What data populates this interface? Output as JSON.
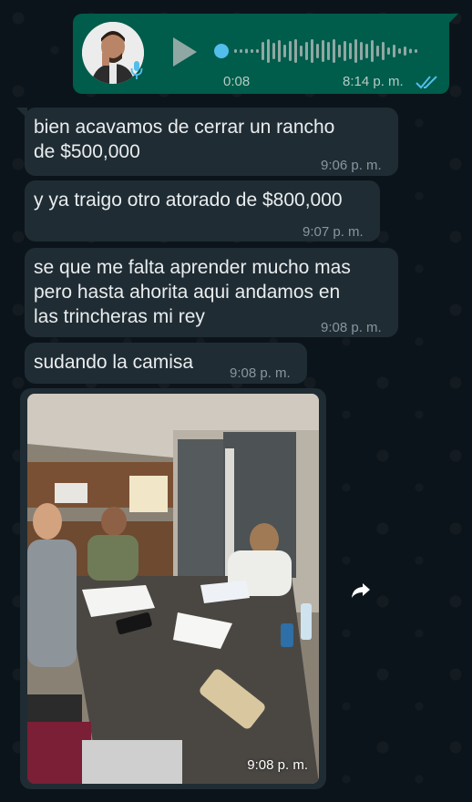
{
  "voice_note": {
    "duration": "0:08",
    "time": "8:14 p. m.",
    "status": "read"
  },
  "messages": [
    {
      "text": "bien acavamos de cerrar un rancho\nde $500,000",
      "time": "9:06 p. m."
    },
    {
      "text": "y ya traigo otro atorado de $800,000",
      "time": "9:07 p. m."
    },
    {
      "text": "se que me falta aprender mucho mas\npero hasta ahorita aqui andamos en\nlas trincheras mi rey",
      "time": "9:08 p. m."
    },
    {
      "text": "sudando la camisa",
      "time": "9:08 p. m."
    }
  ],
  "image_message": {
    "time": "9:08 p. m."
  },
  "colors": {
    "outgoing_bubble": "#005c4b",
    "incoming_bubble": "#202c33",
    "read_ticks": "#53bdeb",
    "background": "#0b141a"
  },
  "icons": [
    "play-icon",
    "mic-icon",
    "double-check-icon",
    "forward-icon"
  ]
}
